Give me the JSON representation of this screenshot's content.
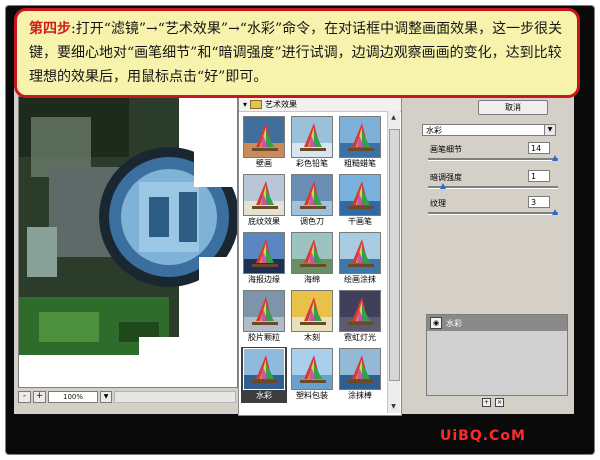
{
  "banner": {
    "step": "第四步",
    "text": ":打开“滤镜”→“艺术效果”→“水彩”命令，在对话框中调整画面效果，这一步很关键，要细心地对“画笔细节”和“暗调强度”进行试调，边调边观察画画的变化，达到比较理想的效果后，用鼠标点击“好”即可。"
  },
  "preview": {
    "zoom_minus": "-",
    "zoom_plus": "+",
    "zoom_value": "100%",
    "zoom_dropdown_icon": "chevron-down-icon"
  },
  "gallery": {
    "category": "艺术效果",
    "filters": [
      {
        "label": "壁画"
      },
      {
        "label": "彩色铅笔"
      },
      {
        "label": "粗糙蜡笔"
      },
      {
        "label": "底纹效果"
      },
      {
        "label": "调色刀"
      },
      {
        "label": "干画笔"
      },
      {
        "label": "海报边缘"
      },
      {
        "label": "海绵"
      },
      {
        "label": "绘画涂抹"
      },
      {
        "label": "胶片颗粒"
      },
      {
        "label": "木刻"
      },
      {
        "label": "霓虹灯光"
      },
      {
        "label": "水彩"
      },
      {
        "label": "塑料包装"
      },
      {
        "label": "涂抹棒"
      }
    ],
    "selected": "水彩"
  },
  "options": {
    "cancel_label": "取消",
    "filter_select_value": "水彩",
    "params": [
      {
        "label": "画笔细节",
        "value": "14",
        "fraction": 1.0
      },
      {
        "label": "暗调强度",
        "value": "1",
        "fraction": 0.1
      },
      {
        "label": "纹理",
        "value": "3",
        "fraction": 1.0
      }
    ],
    "layer_name": "水彩"
  },
  "watermark": "UiBQ.CoM",
  "colors": {
    "banner_bg": "#f7f3ad",
    "banner_border": "#c8161e",
    "step_color": "#d11a1a",
    "knob": "#2a6ad4",
    "watermark": "#ff2a2a"
  }
}
